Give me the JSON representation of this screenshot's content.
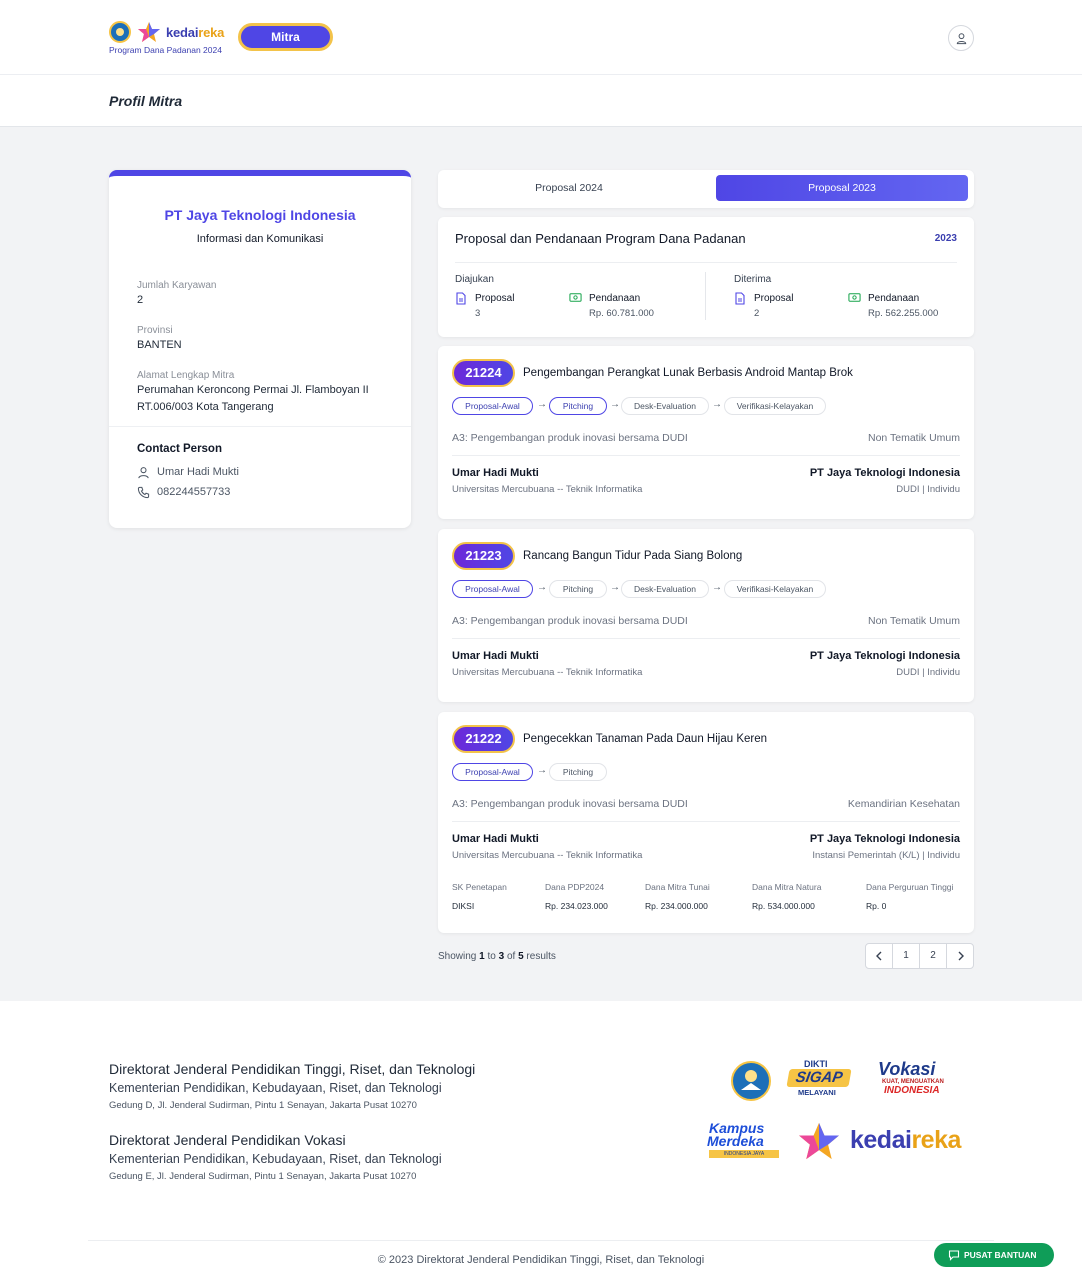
{
  "header": {
    "brand_name_left": "kedai",
    "brand_name_right": "reka",
    "tagline": "Program Dana Padanan 2024",
    "role_button": "Mitra"
  },
  "page": {
    "title": "Profil Mitra"
  },
  "profile": {
    "company": "PT Jaya Teknologi Indonesia",
    "sector": "Informasi dan Komunikasi",
    "employees_label": "Jumlah Karyawan",
    "employees_value": "2",
    "province_label": "Provinsi",
    "province_value": "BANTEN",
    "address_label": "Alamat Lengkap Mitra",
    "address_value": "Perumahan Keroncong Permai Jl. Flamboyan II RT.006/003 Kota Tangerang",
    "contact_title": "Contact Person",
    "contact_name": "Umar Hadi Mukti",
    "contact_phone": "082244557733"
  },
  "tabs": [
    {
      "label": "Proposal 2024",
      "active": false
    },
    {
      "label": "Proposal 2023",
      "active": true
    }
  ],
  "summary": {
    "title": "Proposal dan Pendanaan Program Dana Padanan",
    "year": "2023",
    "submitted": {
      "label": "Diajukan",
      "proposal_label": "Proposal",
      "proposal_value": "3",
      "funding_label": "Pendanaan",
      "funding_value": "Rp. 60.781.000"
    },
    "accepted": {
      "label": "Diterima",
      "proposal_label": "Proposal",
      "proposal_value": "2",
      "funding_label": "Pendanaan",
      "funding_value": "Rp. 562.255.000"
    }
  },
  "proposals": [
    {
      "id": "21224",
      "title": "Pengembangan Perangkat Lunak Berbasis Android Mantap Brok",
      "stages": [
        "Proposal-Awal",
        "Pitching",
        "Desk-Evaluation",
        "Verifikasi-Kelayakan"
      ],
      "active_stages": 2,
      "scheme": "A3: Pengembangan produk inovasi bersama DUDI",
      "theme": "Non Tematik Umum",
      "person": "Umar Hadi Mukti",
      "university": "Universitas Mercubuana -- Teknik Informatika",
      "company": "PT Jaya Teknologi Indonesia",
      "company_type": "DUDI | Individu"
    },
    {
      "id": "21223",
      "title": "Rancang Bangun Tidur Pada Siang Bolong",
      "stages": [
        "Proposal-Awal",
        "Pitching",
        "Desk-Evaluation",
        "Verifikasi-Kelayakan"
      ],
      "active_stages": 1,
      "scheme": "A3: Pengembangan produk inovasi bersama DUDI",
      "theme": "Non Tematik Umum",
      "person": "Umar Hadi Mukti",
      "university": "Universitas Mercubuana -- Teknik Informatika",
      "company": "PT Jaya Teknologi Indonesia",
      "company_type": "DUDI | Individu"
    },
    {
      "id": "21222",
      "title": "Pengecekkan Tanaman Pada Daun Hijau Keren",
      "stages": [
        "Proposal-Awal",
        "Pitching"
      ],
      "active_stages": 1,
      "scheme": "A3: Pengembangan produk inovasi bersama DUDI",
      "theme": "Kemandirian Kesehatan",
      "person": "Umar Hadi Mukti",
      "university": "Universitas Mercubuana -- Teknik Informatika",
      "company": "PT Jaya Teknologi Indonesia",
      "company_type": "Instansi Pemerintah (K/L) | Individu",
      "funding": {
        "headers": [
          "SK Penetapan",
          "Dana PDP2024",
          "Dana Mitra Tunai",
          "Dana Mitra Natura",
          "Dana Perguruan Tinggi"
        ],
        "values": [
          "DIKSI",
          "Rp. 234.023.000",
          "Rp. 234.000.000",
          "Rp. 534.000.000",
          "Rp. 0"
        ]
      }
    }
  ],
  "pagination": {
    "prefix": "Showing",
    "from": "1",
    "to_word": "to",
    "to": "3",
    "of_word": "of",
    "total": "5",
    "suffix": "results",
    "pages": [
      "1",
      "2"
    ]
  },
  "footer": {
    "org1": "Direktorat Jenderal Pendidikan Tinggi, Riset, dan Teknologi",
    "ministry1": "Kementerian Pendidikan, Kebudayaan, Riset, dan Teknologi",
    "address1": "Gedung D, Jl. Jenderal Sudirman, Pintu 1 Senayan, Jakarta Pusat 10270",
    "org2": "Direktorat Jenderal Pendidikan Vokasi",
    "ministry2": "Kementerian Pendidikan, Kebudayaan, Riset, dan Teknologi",
    "address2": "Gedung E, Jl. Jenderal Sudirman, Pintu 1 Senayan, Jakarta Pusat 10270",
    "logo_dikti_top": "DIKTI",
    "logo_dikti_main": "SIGAP",
    "logo_dikti_bottom": "MELAYANI",
    "logo_vokasi": "Vokasi",
    "logo_vokasi_sub": "KUAT, MENGUATKAN",
    "logo_vokasi_country": "INDONESIA",
    "logo_kampus_1": "Kampus",
    "logo_kampus_2": "Merdeka",
    "logo_kampus_3": "INDONESIA JAYA",
    "logo_kedai_1": "kedai",
    "logo_kedai_2": "reka",
    "copyright": "© 2023 Direktorat Jenderal Pendidikan Tinggi, Riset, dan Teknologi",
    "help_button": "PUSAT BANTUAN"
  },
  "colors": {
    "primary": "#4f46e5",
    "accent_yellow": "#f3c34a",
    "help_green": "#0f9d58"
  }
}
